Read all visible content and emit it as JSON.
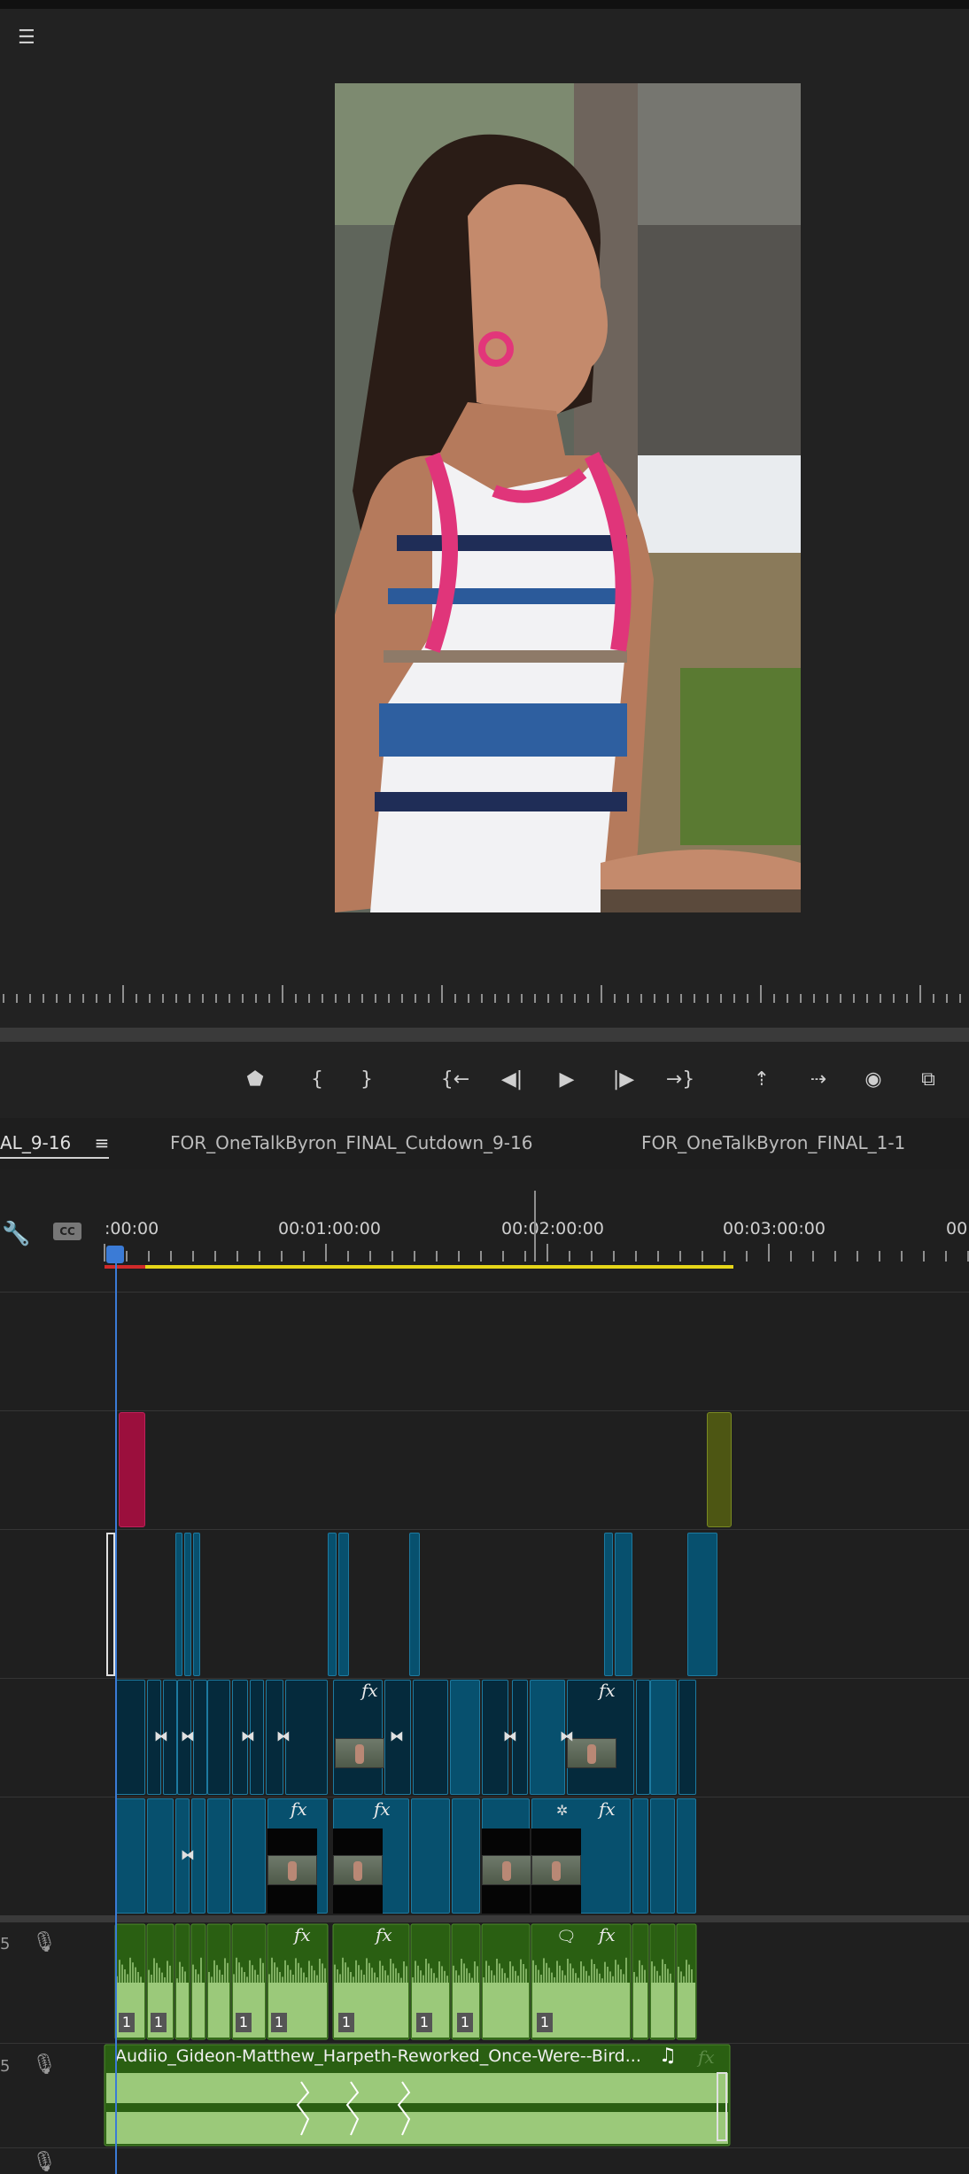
{
  "monitor": {
    "menu_icon": "hamburger-menu-icon",
    "transport_buttons": [
      "add-marker-icon",
      "mark-in-icon",
      "mark-out-icon",
      "go-to-in-icon",
      "step-back-icon",
      "play-icon",
      "step-forward-icon",
      "go-to-out-icon",
      "lift-icon",
      "extract-icon",
      "export-frame-icon",
      "compare-icon"
    ],
    "transport_glyphs": [
      "⬟",
      "{",
      "}",
      "{←",
      "◀|",
      "▶",
      "|▶",
      "→}",
      "⇡",
      "⇢",
      "◉",
      "⧉"
    ]
  },
  "timeline": {
    "tabs": [
      "AL_9-16",
      "FOR_OneTalkByron_FINAL_Cutdown_9-16",
      "FOR_OneTalkByron_FINAL_1-1"
    ],
    "tab_menu_glyph": "≡",
    "timecodes": [
      ":00:00",
      "00:01:00:00",
      "00:02:00:00",
      "00:03:00:00",
      "00"
    ],
    "cc_label": "CC",
    "fx_label": "fx",
    "clip_numbers": [
      "1",
      "1",
      "1",
      "1",
      "1",
      "1",
      "1",
      "1"
    ],
    "audio_clip_name": "Audiio_Gideon-Matthew_Harpeth-Reworked_Once-Were--Bird...",
    "audio_track_labels": [
      "5",
      "5"
    ],
    "music_note": "♫",
    "colors": {
      "accent_blue": "#2f6bd4",
      "playhead": "#3b7bd6",
      "work_area": "#e6d619",
      "video_clip": "#07506e",
      "audio_clip": "#2a5f12",
      "audio_waveform": "#9bc97a",
      "graphic_clip_pink": "#9b0f3d",
      "graphic_clip_olive": "#4d5613"
    }
  }
}
